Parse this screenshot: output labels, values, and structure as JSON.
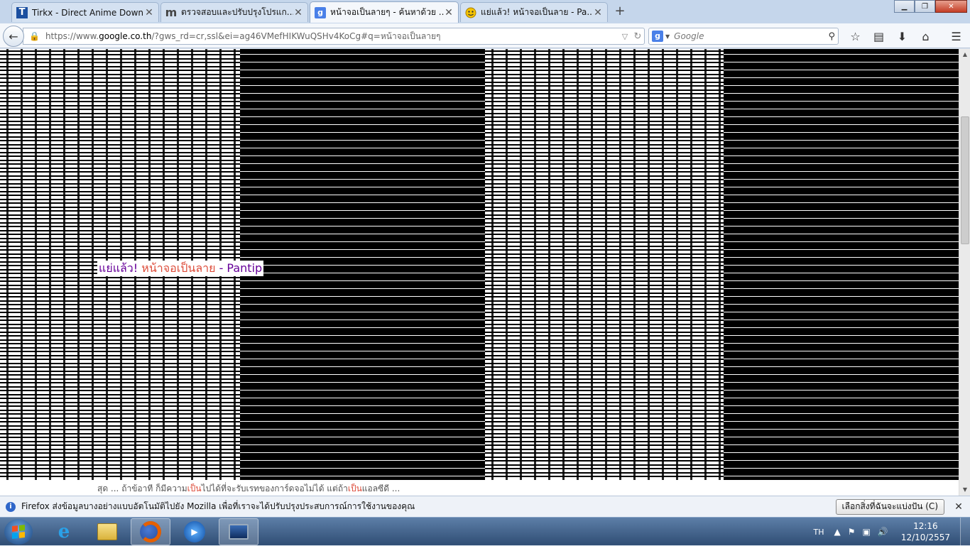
{
  "tabs": [
    {
      "label": "Tirkx - Direct Anime Downl...",
      "favicon": "T",
      "active": false
    },
    {
      "label": "ตรวจสอบและปรับปรุงโปรแก...",
      "favicon": "m",
      "active": false
    },
    {
      "label": "หน้าจอเป็นลายๆ - ค้นหาด้วย ...",
      "favicon": "g",
      "active": true
    },
    {
      "label": "แย่แล้ว! หน้าจอเป็นลาย - Pa...",
      "favicon": "pantip-emoji",
      "active": false
    }
  ],
  "new_tab_label": "+",
  "address": {
    "url_prefix": "https://www.",
    "url_domain": "google.co.th",
    "url_rest": "/?gws_rd=cr,ssl&ei=ag46VMefHIKWuQSHv4KoCg#q=หน้าจอเป็นลายๆ"
  },
  "search": {
    "placeholder": "Google",
    "engine": "g"
  },
  "content": {
    "result_title_part1": "แย่แล้ว! ",
    "result_title_part2": "หน้าจอเป็นลาย",
    "result_title_part3": " - Pantip",
    "snippet_part1": "สุด ... ถ้าข้อาที ก็มีความ",
    "snippet_hl1": "เป็น",
    "snippet_part2": "ไปได้ที่จะรับเรทของการ์ดจอไม่ได้ แต่ถ้า",
    "snippet_hl2": "เป็น",
    "snippet_part3": "แอลซีดี ..."
  },
  "notification": {
    "message": "Firefox ส่งข้อมูลบางอย่างแบบอัตโนมัติไปยัง Mozilla เพื่อที่เราจะได้ปรับปรุงประสบการณ์การใช้งานของคุณ",
    "button_label": "เลือกสิ่งที่ฉันจะแบ่งปัน (C)",
    "close": "✕"
  },
  "taskbar": {
    "language": "TH",
    "time": "12:16",
    "date": "12/10/2557"
  },
  "colors": {
    "visited_link": "#660099",
    "highlight": "#dd4b39",
    "taskbar": "#2f4d74"
  }
}
